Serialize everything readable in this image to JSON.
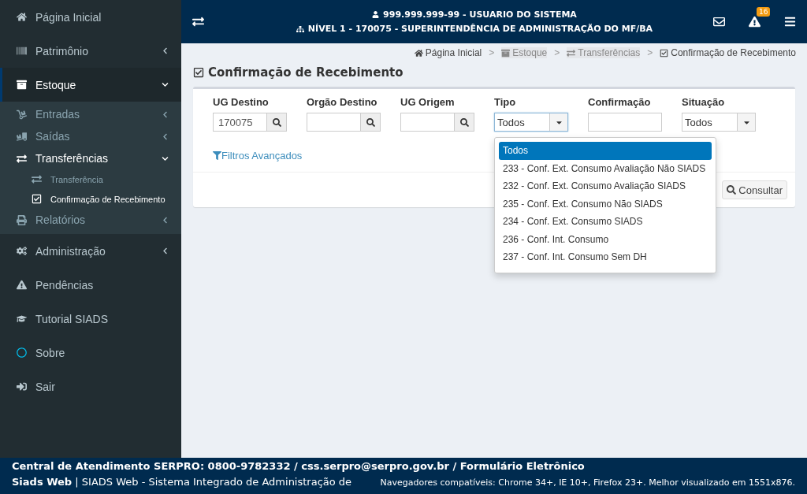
{
  "sidebar": {
    "items": [
      {
        "label": "Página Inicial",
        "selected": false
      },
      {
        "label": "Patrimônio",
        "selected": false,
        "expanded": false
      },
      {
        "label": "Estoque",
        "selected": true,
        "expanded": true,
        "children": [
          {
            "label": "Entradas",
            "selected": false,
            "expanded": false
          },
          {
            "label": "Saídas",
            "selected": false,
            "expanded": false
          },
          {
            "label": "Transferências",
            "selected": true,
            "expanded": true,
            "children": [
              {
                "label": "Transferência",
                "selected": false
              },
              {
                "label": "Confirmação de Recebimento",
                "selected": true
              }
            ]
          },
          {
            "label": "Relatórios",
            "selected": false,
            "expanded": false
          }
        ]
      },
      {
        "label": "Administração",
        "selected": false,
        "expanded": false
      },
      {
        "label": "Pendências",
        "selected": false
      },
      {
        "label": "Tutorial SIADS",
        "selected": false
      },
      {
        "label": "Sobre",
        "selected": false
      },
      {
        "label": "Sair",
        "selected": false
      }
    ]
  },
  "header": {
    "user": "999.999.999-99 - USUARIO DO SISTEMA",
    "unit": "NÍVEL 1 - 170075 - SUPERINTENDÊNCIA DE ADMINISTRAÇÃO DO MF/BA",
    "alerts_badge": "16"
  },
  "page_title": "Confirmação de Recebimento",
  "breadcrumb": {
    "separator": ">",
    "items": [
      {
        "label": "Página Inicial",
        "disabled": false
      },
      {
        "label": "Estoque",
        "disabled": true
      },
      {
        "label": "Transferências",
        "disabled": true
      },
      {
        "label": "Confirmação de Recebimento",
        "disabled": false
      }
    ]
  },
  "filters": [
    {
      "kind": "lookup",
      "label": "UG Destino",
      "value": "170075"
    },
    {
      "kind": "lookup",
      "label": "Orgão Destino"
    },
    {
      "kind": "lookup",
      "label": "UG Origem"
    },
    {
      "kind": "select",
      "label": "Tipo",
      "value": "Todos",
      "open": true,
      "options": [
        {
          "label": "Todos",
          "selected": true
        },
        {
          "label": "233 - Conf. Ext. Consumo Avaliação Não SIADS",
          "selected": false
        },
        {
          "label": "232 - Conf. Ext. Consumo Avaliação SIADS",
          "selected": false
        },
        {
          "label": "235 - Conf. Ext. Consumo Não SIADS",
          "selected": false
        },
        {
          "label": "234 - Conf. Ext. Consumo SIADS",
          "selected": false
        },
        {
          "label": "236 - Conf. Int. Consumo",
          "selected": false
        },
        {
          "label": "237 - Conf. Int. Consumo Sem DH",
          "selected": false
        }
      ]
    },
    {
      "kind": "text",
      "label": "Confirmação"
    },
    {
      "kind": "select",
      "label": "Situação",
      "value": "Todos",
      "open": false
    }
  ],
  "advanced_filters_link": "Filtros Avançados",
  "search_button": "Consultar",
  "footer": {
    "contact": "Central de Atendimento SERPRO: 0800-9782332 / css.serpro@serpro.gov.br / Formulário Eletrônico",
    "system": "**Siads Web** | SIADS Web - Sistema Integrado de Administração de",
    "browsers": "Navegadores compatíveis: Chrome 34+, IE 10+, Firefox 23+. Melhor visualizado em 1551x876."
  }
}
